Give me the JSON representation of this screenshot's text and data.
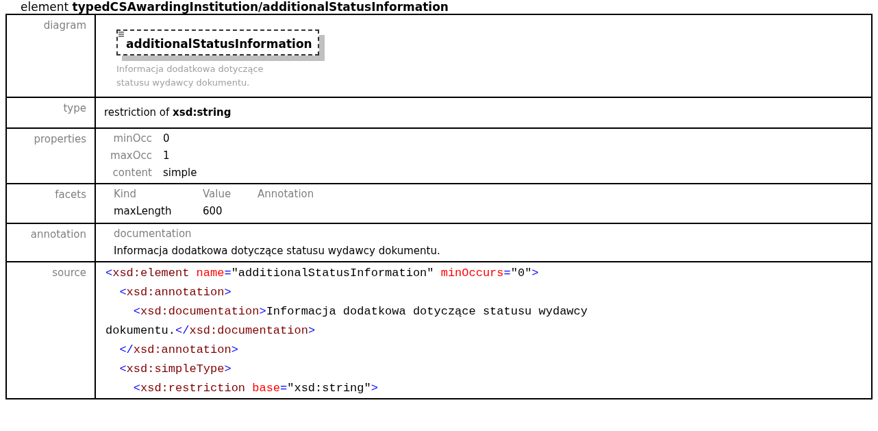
{
  "heading": "element **typedCSAwardingInstitution/additionalStatusInformation**",
  "rows": [
    {
      "kind": "diagram",
      "label": "diagram",
      "element_name": "additionalStatusInformation",
      "description": [
        "Informacja dodatkowa dotyczące",
        "statusu wydawcy dokumentu."
      ]
    },
    {
      "kind": "type",
      "label": "type",
      "text": "restriction of **xsd:string**"
    },
    {
      "kind": "properties",
      "label": "properties",
      "items": [
        {
          "name": "minOcc",
          "value": "0"
        },
        {
          "name": "maxOcc",
          "value": "1"
        },
        {
          "name": "content",
          "value": "simple"
        }
      ]
    },
    {
      "kind": "facets",
      "label": "facets",
      "columns": [
        "Kind",
        "Value",
        "Annotation"
      ],
      "items": [
        {
          "kind_text": "maxLength",
          "value": "600"
        }
      ]
    },
    {
      "kind": "annotation",
      "label": "annotation",
      "title": "documentation",
      "text": "Informacja dodatkowa dotyczące statusu wydawcy dokumentu."
    },
    {
      "kind": "source",
      "label": "source",
      "lines": [
        [
          {
            "kind": "punct",
            "text": "<"
          },
          {
            "kind": "tag",
            "text": "xsd:element"
          },
          {
            "kind": "attr",
            "text": " name"
          },
          {
            "kind": "punct",
            "text": "="
          },
          {
            "kind": "text",
            "text": "\"additionalStatusInformation\""
          },
          {
            "kind": "attr",
            "text": " minOccurs"
          },
          {
            "kind": "punct",
            "text": "="
          },
          {
            "kind": "text",
            "text": "\"0\""
          },
          {
            "kind": "punct",
            "text": ">"
          }
        ],
        [
          {
            "kind": "punct",
            "text": "  <"
          },
          {
            "kind": "tag",
            "text": "xsd:annotation"
          },
          {
            "kind": "punct",
            "text": ">"
          }
        ],
        [
          {
            "kind": "punct",
            "text": "    <"
          },
          {
            "kind": "tag",
            "text": "xsd:documentation"
          },
          {
            "kind": "punct",
            "text": ">"
          },
          {
            "kind": "text",
            "text": "Informacja dodatkowa dotyczące statusu wydawcy"
          }
        ],
        [
          {
            "kind": "text",
            "text": "dokumentu."
          },
          {
            "kind": "punct",
            "text": "</"
          },
          {
            "kind": "tag",
            "text": "xsd:documentation"
          },
          {
            "kind": "punct",
            "text": ">"
          }
        ],
        [
          {
            "kind": "punct",
            "text": "  </"
          },
          {
            "kind": "tag",
            "text": "xsd:annotation"
          },
          {
            "kind": "punct",
            "text": ">"
          }
        ],
        [
          {
            "kind": "punct",
            "text": "  <"
          },
          {
            "kind": "tag",
            "text": "xsd:simpleType"
          },
          {
            "kind": "punct",
            "text": ">"
          }
        ],
        [
          {
            "kind": "punct",
            "text": "    <"
          },
          {
            "kind": "tag",
            "text": "xsd:restriction"
          },
          {
            "kind": "attr",
            "text": " base"
          },
          {
            "kind": "punct",
            "text": "="
          },
          {
            "kind": "text",
            "text": "\"xsd:string\""
          },
          {
            "kind": "punct",
            "text": ">"
          }
        ]
      ]
    }
  ]
}
